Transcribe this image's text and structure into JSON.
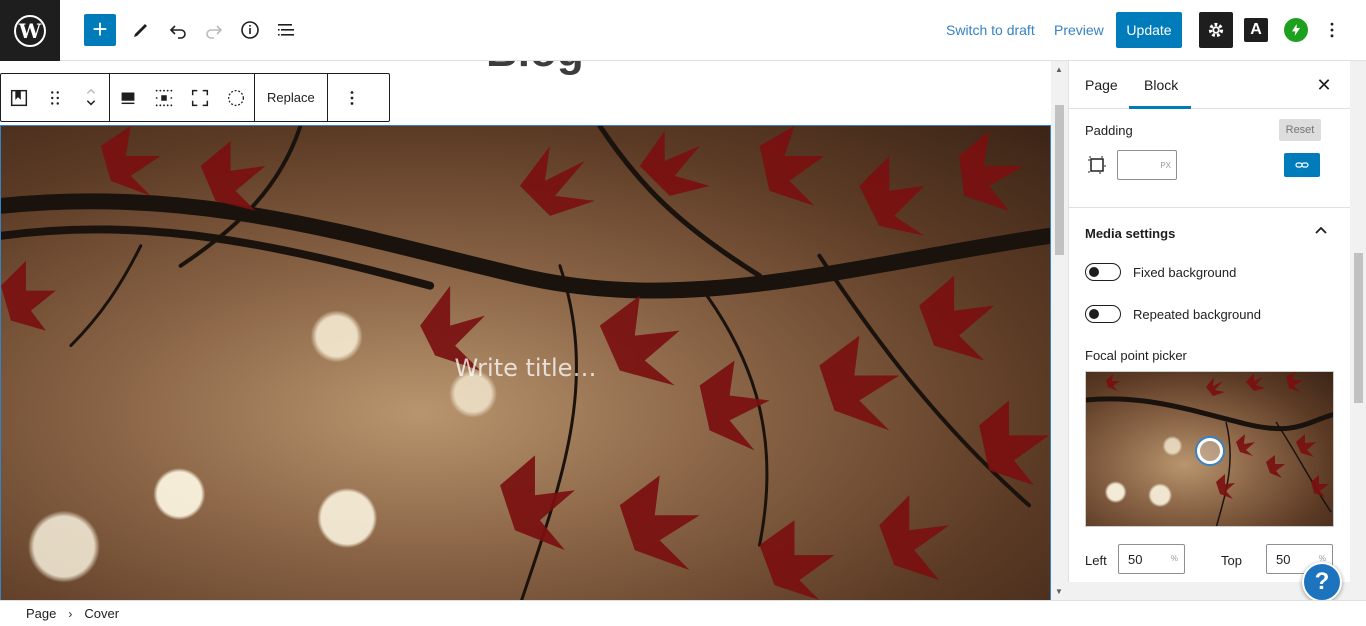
{
  "topbar": {
    "switch_to_draft": "Switch to draft",
    "preview": "Preview",
    "update": "Update",
    "icons": [
      "wordpress-logo",
      "add-block-icon",
      "pen-icon",
      "undo-icon",
      "redo-icon",
      "info-icon",
      "list-view-icon",
      "settings-gear-icon",
      "a-icon",
      "bolt-icon",
      "more-vertical-icon"
    ]
  },
  "canvas": {
    "post_title": "Blog",
    "cover_title_placeholder": "Write title…"
  },
  "block_toolbar": {
    "replace_label": "Replace"
  },
  "sidebar": {
    "tabs": [
      {
        "label": "Page"
      },
      {
        "label": "Block"
      }
    ],
    "active_tab": "Block",
    "padding": {
      "label": "Padding",
      "reset": "Reset",
      "value": "",
      "unit": "PX"
    },
    "media_settings": {
      "title": "Media settings",
      "fixed_background": {
        "label": "Fixed background",
        "enabled": false
      },
      "repeated_background": {
        "label": "Repeated background",
        "enabled": false
      },
      "focal_point_label": "Focal point picker",
      "left_label": "Left",
      "left_value": "50",
      "top_label": "Top",
      "top_value": "50",
      "unit": "%"
    }
  },
  "help": {
    "label": "?"
  },
  "breadcrumb": {
    "items": [
      "Page",
      "Cover"
    ]
  },
  "colors": {
    "accent": "#007cba",
    "dark": "#1e1e1e"
  }
}
